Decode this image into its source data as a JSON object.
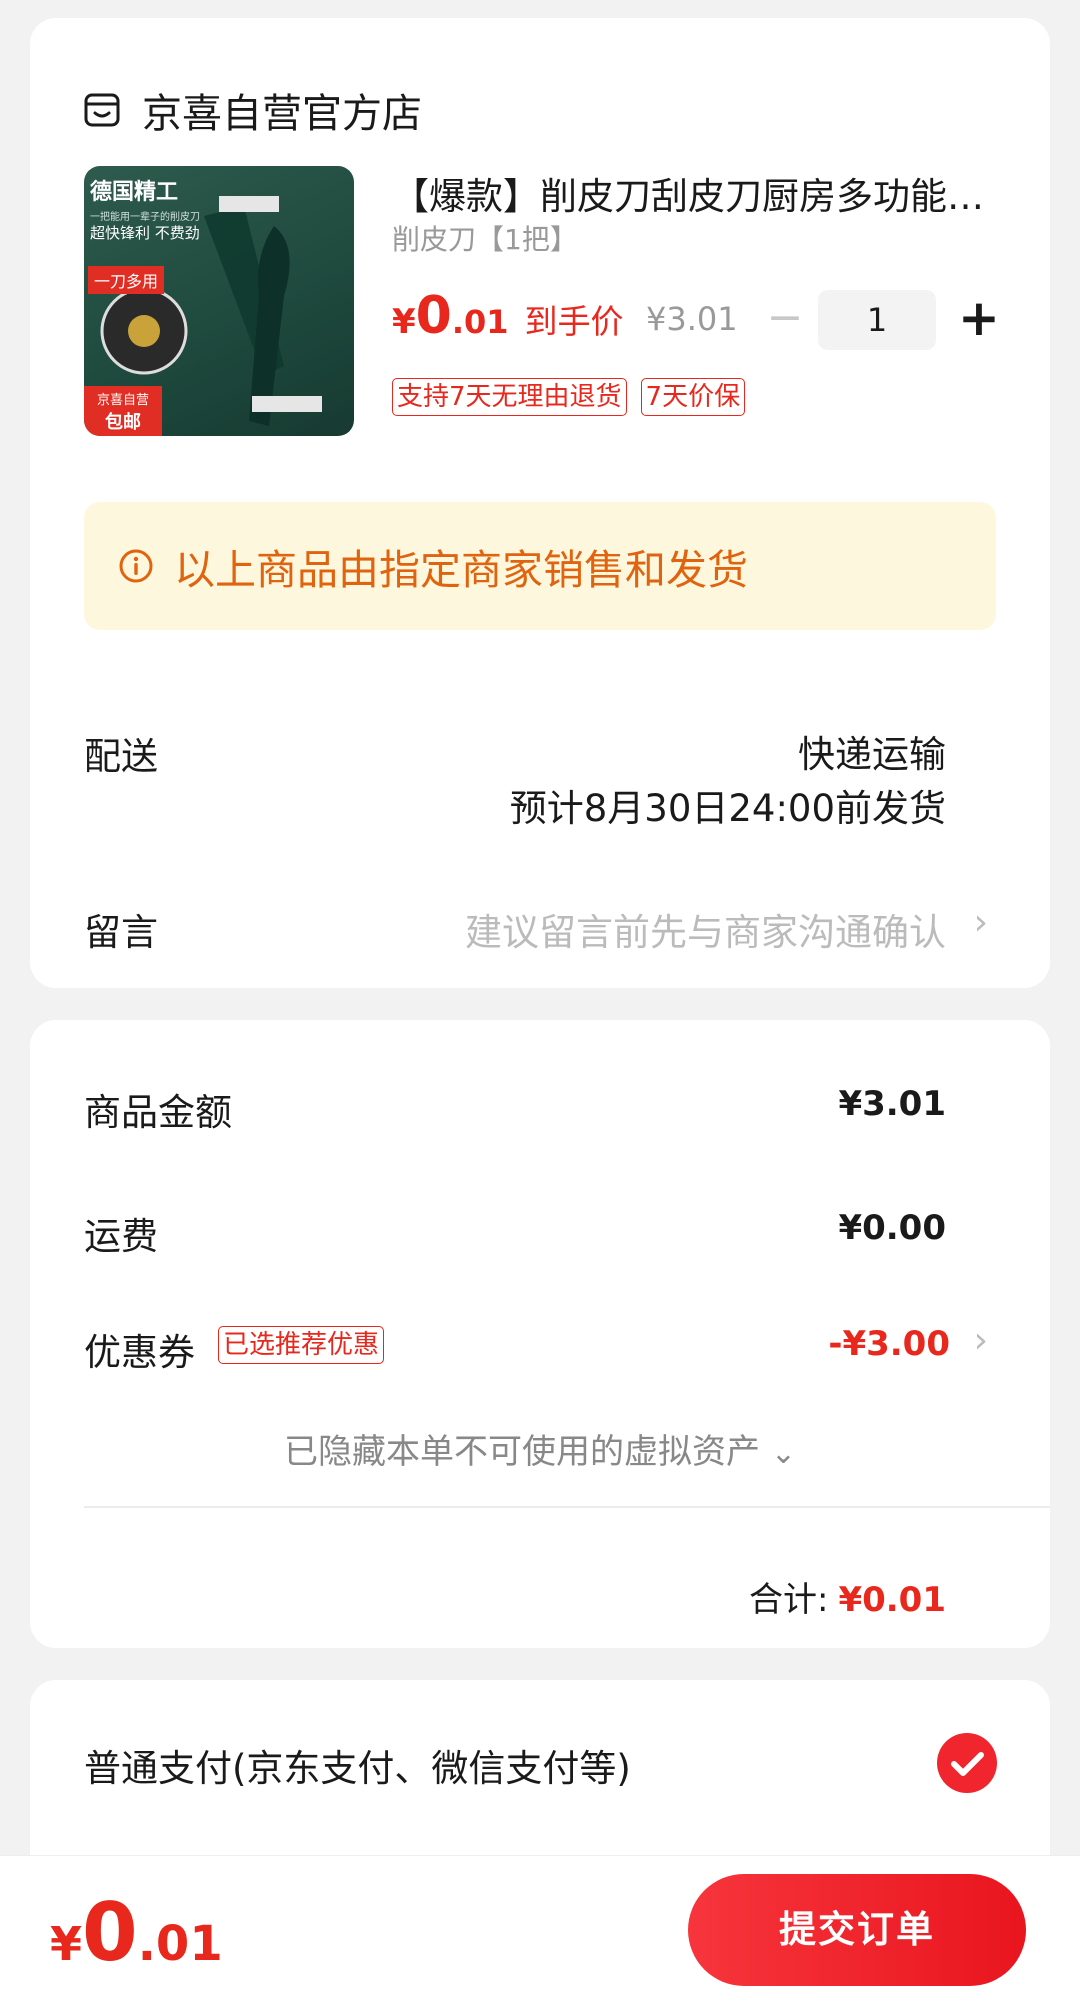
{
  "shop": {
    "name": "京喜自营官方店"
  },
  "product": {
    "title": "【爆款】削皮刀刮皮刀厨房多功能家用",
    "spec": "削皮刀【1把】",
    "price_symbol": "¥",
    "price_int": "0",
    "price_dec": ".01",
    "price_label": "到手价",
    "original_price": "¥3.01",
    "quantity": "1",
    "minus_label": "−",
    "plus_label": "+",
    "badges": [
      "支持7天无理由退货",
      "7天价保"
    ],
    "image_text": {
      "line1": "德国精工",
      "line2": "一把能用一辈子的削皮刀",
      "line3": "超快锋利 不费劲",
      "tag": "一刀多用",
      "corner_line1": "京喜自营",
      "corner_line2": "包邮"
    }
  },
  "notice": {
    "text": "以上商品由指定商家销售和发货"
  },
  "delivery": {
    "label": "配送",
    "method": "快递运输",
    "estimate": "预计8月30日24:00前发货"
  },
  "message": {
    "label": "留言",
    "placeholder": "建议留言前先与商家沟通确认"
  },
  "amounts": {
    "goods_label": "商品金额",
    "goods_value": "¥3.01",
    "shipping_label": "运费",
    "shipping_value": "¥0.00",
    "coupon_label": "优惠券",
    "coupon_tag": "已选推荐优惠",
    "coupon_value": "-¥3.00",
    "hidden_assets": "已隐藏本单不可使用的虚拟资产",
    "hidden_assets_chevron": "⌄",
    "total_label": "合计:",
    "total_value": "¥0.01"
  },
  "payment": {
    "label": "普通支付(京东支付、微信支付等)"
  },
  "footer": {
    "price_symbol": "¥",
    "price_int": "0",
    "price_dec": ".01",
    "submit_label": "提交订单"
  },
  "chevron": "›",
  "colors": {
    "accent": "#e8271d",
    "notice_bg": "#fdf8dd",
    "notice_text": "#e0640f",
    "page_bg": "#f2f2f2"
  }
}
